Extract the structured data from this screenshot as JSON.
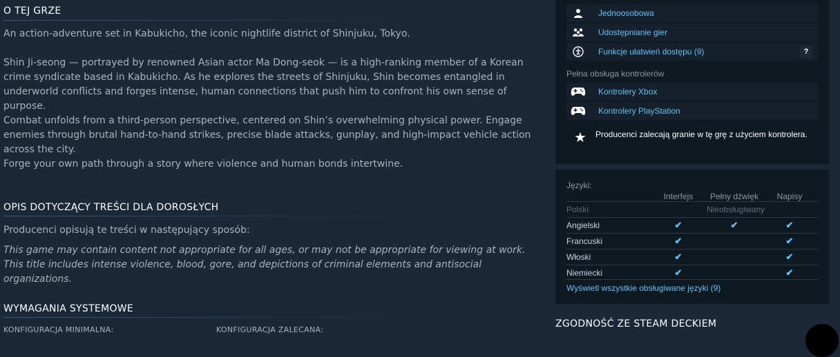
{
  "about": {
    "title": "O TEJ GRZE",
    "paragraphs": [
      "An action-adventure set in Kabukicho, the iconic nightlife district of Shinjuku, Tokyo.",
      "Shin Ji-seong — portrayed by renowned Asian actor Ma Dong-seok — is a high-ranking member of a Korean crime syndicate based in Kabukicho. As he explores the streets of Shinjuku, Shin becomes entangled in underworld conflicts and forges intense, human connections that push him to confront his own sense of purpose.",
      "Combat unfolds from a third-person perspective, centered on Shin’s overwhelming physical power. Engage enemies through brutal hand-to-hand strikes, precise blade attacks, gunplay, and high-impact vehicle action across the city.",
      "Forge your own path through a story where violence and human bonds intertwine."
    ]
  },
  "mature": {
    "title": "OPIS DOTYCZĄCY TREŚCI DLA DOROSŁYCH",
    "intro": "Producenci opisują te treści w następujący sposób:",
    "lines": [
      "This game may contain content not appropriate for all ages, or may not be appropriate for viewing at work.",
      "This title includes intense violence, blood, gore, and depictions of criminal elements and antisocial organizations."
    ]
  },
  "requirements": {
    "title": "WYMAGANIA SYSTEMOWE",
    "min_label": "KONFIGURACJA MINIMALNA:",
    "rec_label": "KONFIGURACJA ZALECANA:"
  },
  "features": [
    {
      "icon": "single-player-icon",
      "label": "Jednoosobowa"
    },
    {
      "icon": "family-sharing-icon",
      "label": "Udostępnianie gier"
    },
    {
      "icon": "accessibility-icon",
      "label": "Funkcje ułatwień dostępu (9)",
      "badge": "?"
    }
  ],
  "controllers": {
    "label": "Pełna obsługa kontrolerów",
    "items": [
      {
        "icon": "gamepad-icon",
        "label": "Kontrolery Xbox"
      },
      {
        "icon": "gamepad-icon",
        "label": "Kontrolery PlayStation"
      }
    ],
    "note": "Producenci zalecają granie w tę grę z użyciem kontrolera."
  },
  "languages": {
    "title": "Języki:",
    "columns": [
      "Interfejs",
      "Pełny dźwięk",
      "Napisy"
    ],
    "check_glyph": "✔",
    "rows": [
      {
        "name": "Polski",
        "unsupported": "Nieobsługiwany"
      },
      {
        "name": "Angielski",
        "interface": true,
        "audio": true,
        "subtitles": true
      },
      {
        "name": "Francuski",
        "interface": true,
        "audio": false,
        "subtitles": true
      },
      {
        "name": "Włoski",
        "interface": true,
        "audio": false,
        "subtitles": true
      },
      {
        "name": "Niemiecki",
        "interface": true,
        "audio": false,
        "subtitles": true
      }
    ],
    "link": "Wyświetl wszystkie obsługiwane języki (9)"
  },
  "deck": {
    "title": "ZGODNOŚĆ ZE STEAM DECKIEM"
  },
  "colors": {
    "background": "#1b2838",
    "panel": "#0f1922",
    "link": "#66c0f4"
  }
}
